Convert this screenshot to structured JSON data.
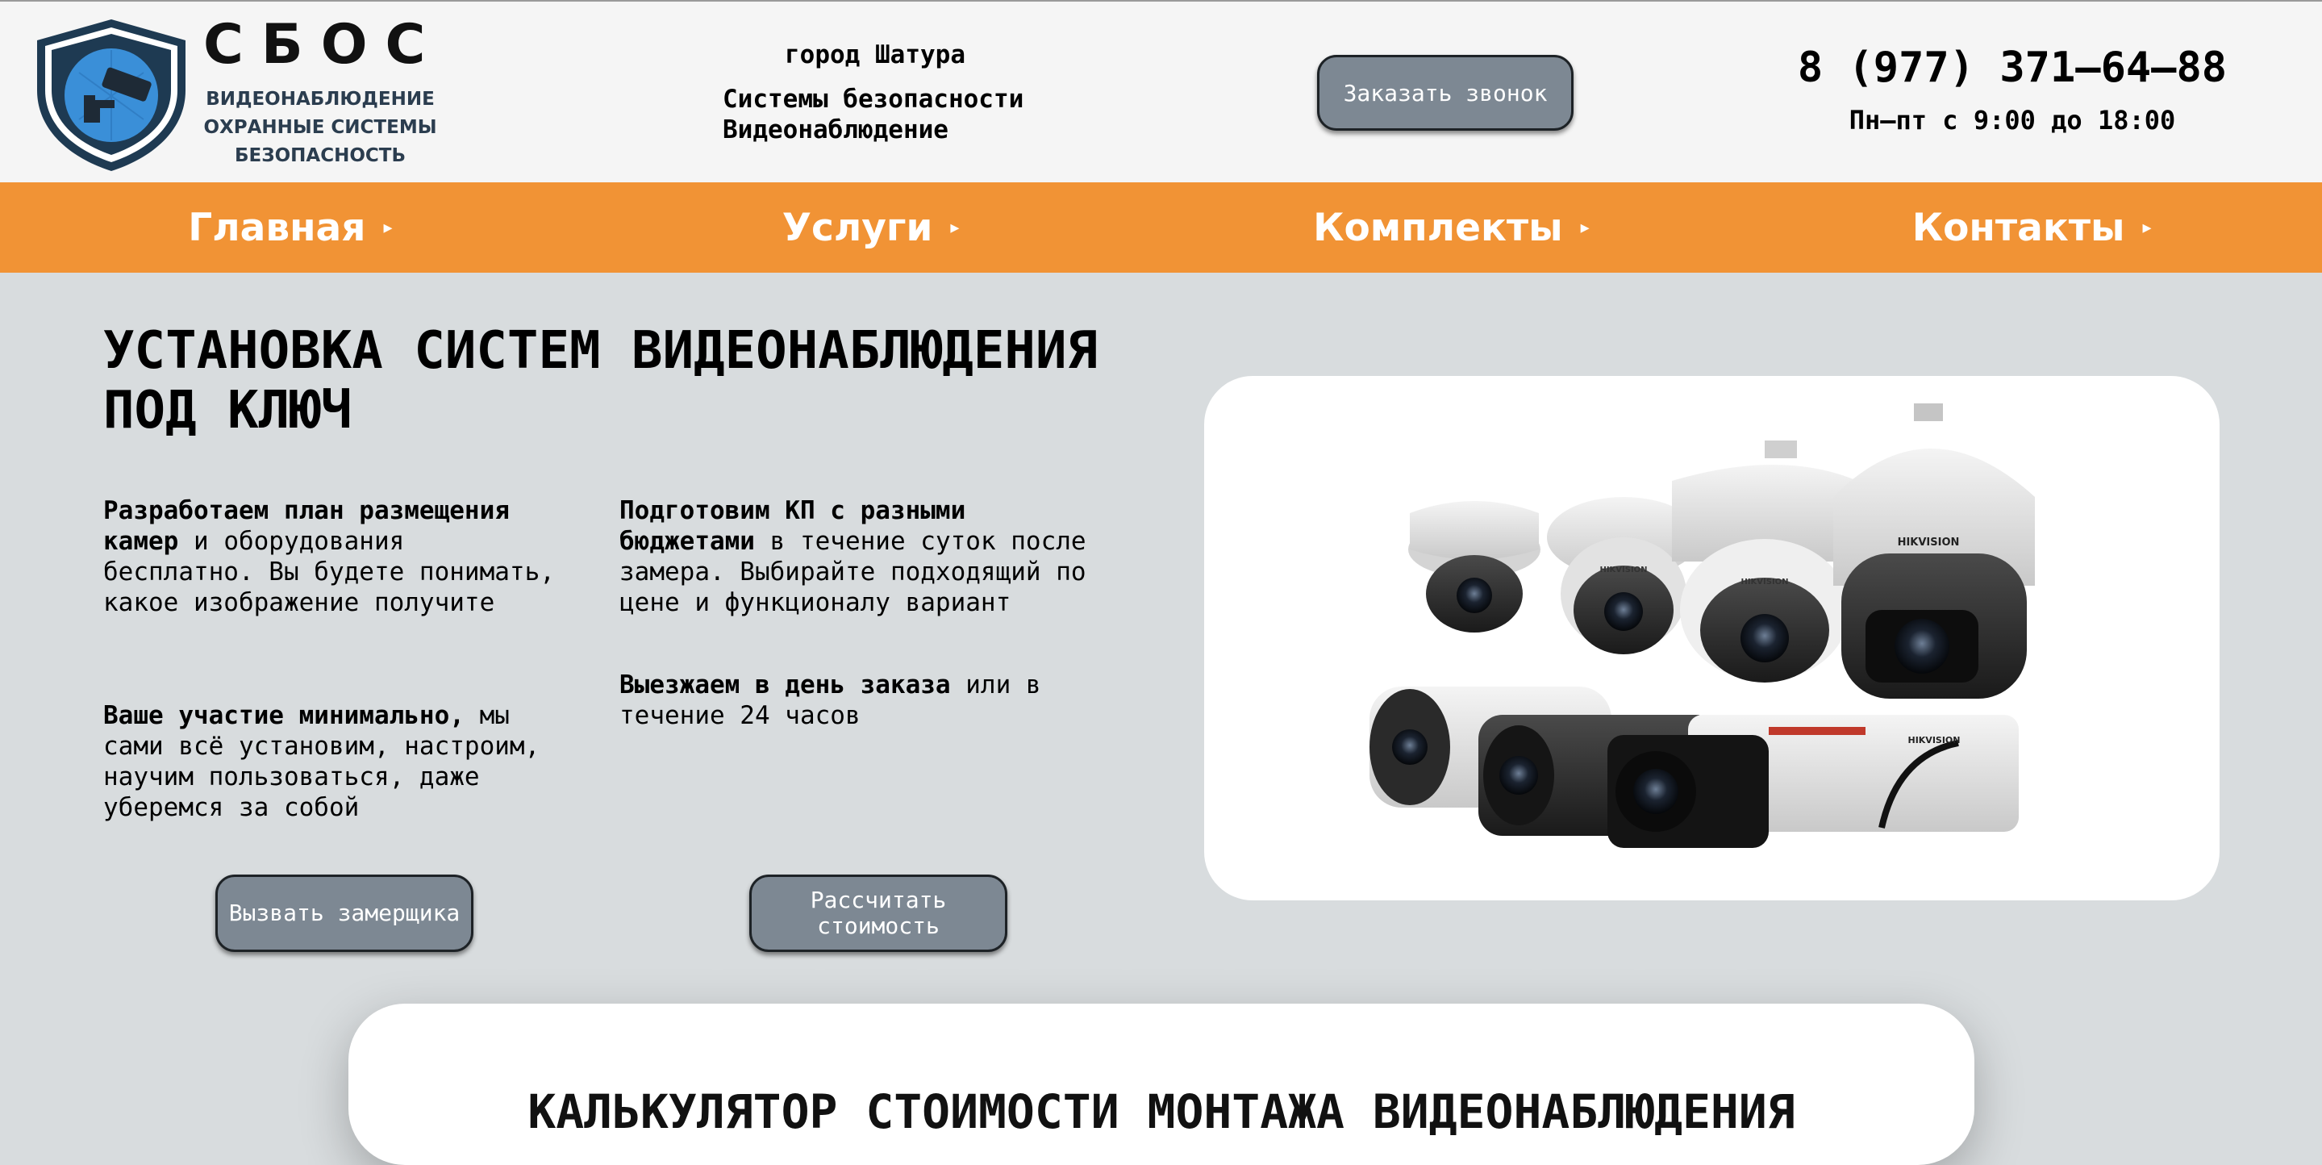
{
  "brand": {
    "name": "СБОС",
    "subtitle_lines": [
      "ВИДЕОНАБЛЮДЕНИЕ",
      "ОХРАННЫЕ СИСТЕМЫ",
      "БЕЗОПАСНОСТЬ"
    ]
  },
  "header": {
    "city": "город Шатура",
    "services_lines": [
      "Системы безопасности",
      "Видеонаблюдение"
    ],
    "callback_label": "Заказать звонок",
    "phone": "8 (977) 371–64–88",
    "hours": "Пн–пт с 9:00 до 18:00"
  },
  "nav": {
    "items": [
      {
        "label": "Главная"
      },
      {
        "label": "Услуги"
      },
      {
        "label": "Комплекты"
      },
      {
        "label": "Контакты"
      }
    ],
    "arrow": "▸"
  },
  "hero": {
    "title_lines": [
      "УСТАНОВКА СИСТЕМ ВИДЕОНАБЛЮДЕНИЯ",
      "ПОД КЛЮЧ"
    ],
    "features": [
      {
        "bold": "Разработаем план размещения камер",
        "text": " и оборудования бесплатно. Вы будете понимать, какое изображение получите"
      },
      {
        "bold": "Подготовим КП с разными бюджетами",
        "text": " в течение суток после замера. Выбирайте подходящий по цене и функционалу вариант"
      },
      {
        "bold": "Ваше участие минимально,",
        "text": " мы сами всё установим, настроим, научим пользоваться, даже уберемся за собой"
      },
      {
        "bold": "Выезжаем в день заказа",
        "text": " или в течение 24 часов"
      }
    ],
    "buttons": {
      "measure": "Вызвать замерщика",
      "calc_line1": "Рассчитать",
      "calc_line2": "стоимость"
    },
    "camera_brand": "HIKVISION"
  },
  "section": {
    "title": "КАЛЬКУЛЯТОР СТОИМОСТИ МОНТАЖА ВИДЕОНАБЛЮДЕНИЯ"
  },
  "colors": {
    "nav_bg": "#f19335",
    "button_bg": "#7d8893",
    "page_bg": "#d8dcde",
    "logo_blue": "#3a8fd8",
    "logo_dark": "#1e3a52"
  }
}
